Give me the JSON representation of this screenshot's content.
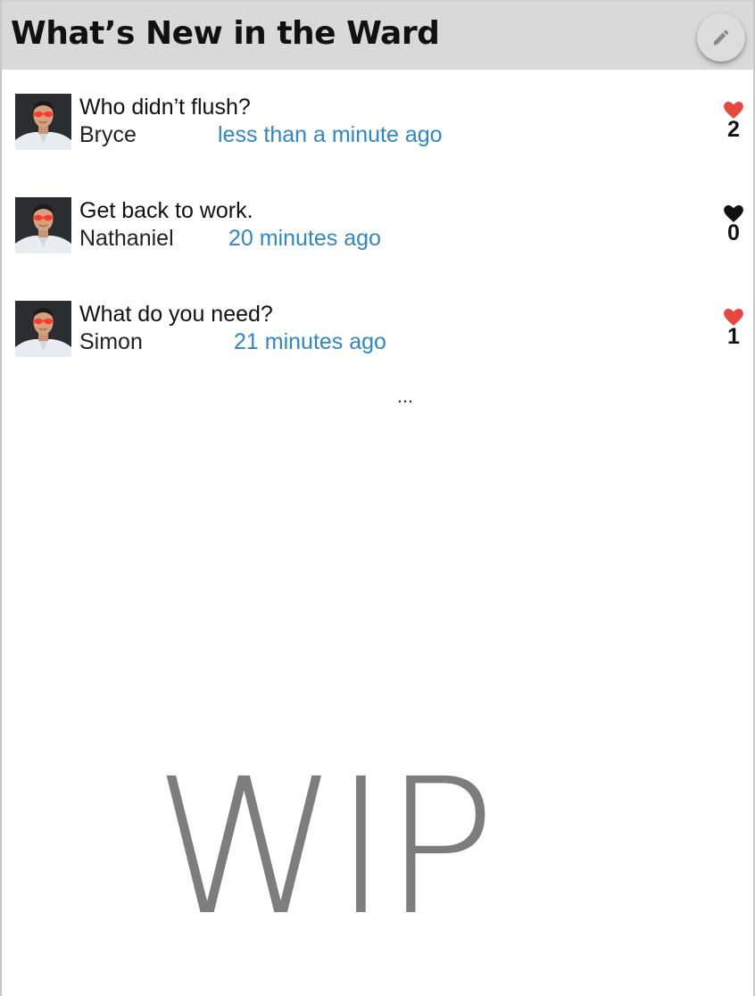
{
  "header": {
    "title": "What’s New in the Ward",
    "edit_icon": "pencil-icon"
  },
  "posts": [
    {
      "title": "Who didn’t flush?",
      "author": "Bryce",
      "time": "less than a minute ago",
      "likes": "2",
      "liked": true,
      "avatar_icon": "user-avatar-photo"
    },
    {
      "title": "Get back to work.",
      "author": "Nathaniel",
      "time": "20 minutes ago",
      "likes": "0",
      "liked": false,
      "avatar_icon": "user-avatar-photo"
    },
    {
      "title": "What do you need?",
      "author": "Simon",
      "time": "21 minutes ago",
      "likes": "1",
      "liked": true,
      "avatar_icon": "user-avatar-photo"
    }
  ],
  "more_indicator": "...",
  "watermark": "WIP",
  "colors": {
    "header_bg": "#d9d9d9",
    "time_link": "#2f86c8",
    "heart_liked": "#e8473f",
    "heart_unliked": "#111111",
    "watermark": "#7d7d7d"
  }
}
